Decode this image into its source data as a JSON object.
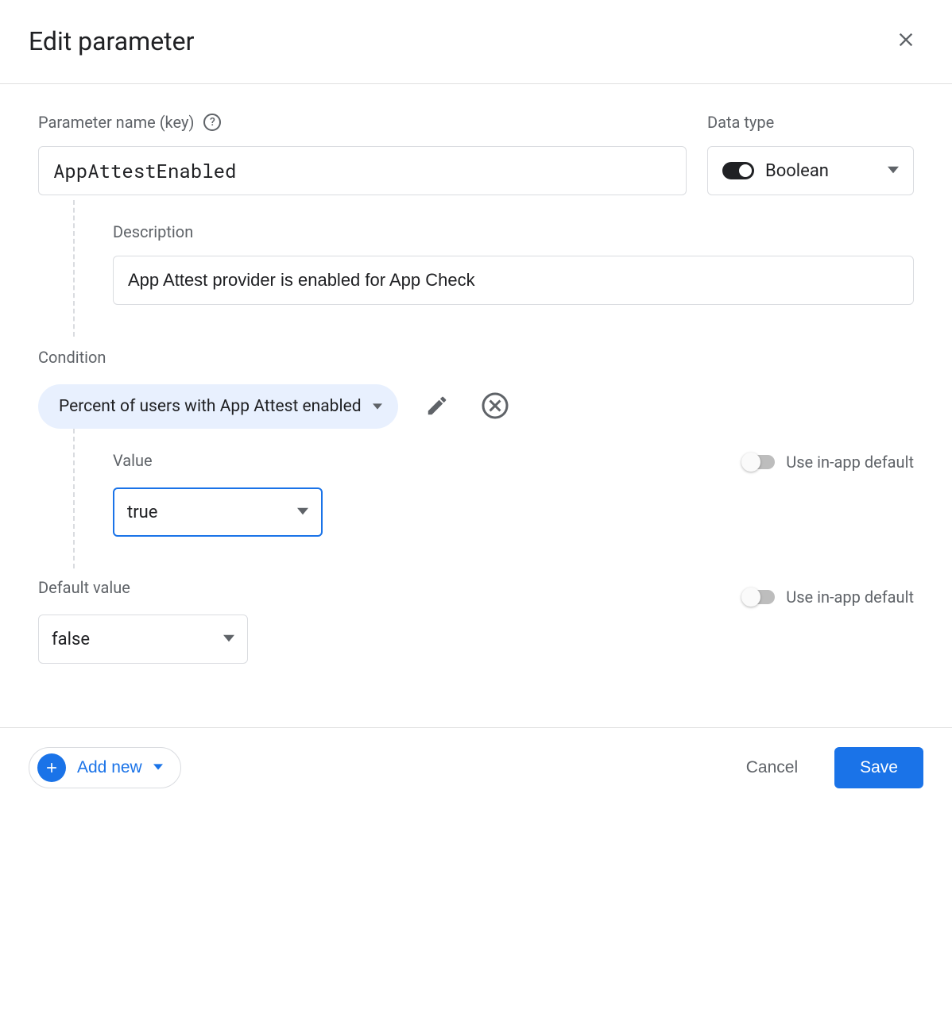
{
  "header": {
    "title": "Edit parameter"
  },
  "param": {
    "name_label": "Parameter name (key)",
    "name_value": "AppAttestEnabled",
    "datatype_label": "Data type",
    "datatype_value": "Boolean"
  },
  "description": {
    "label": "Description",
    "value": "App Attest provider is enabled for App Check"
  },
  "condition": {
    "section_label": "Condition",
    "chip_text": "Percent of users with App Attest enabled",
    "value_label": "Value",
    "value_selected": "true",
    "inapp_label": "Use in-app default"
  },
  "default": {
    "label": "Default value",
    "value_selected": "false",
    "inapp_label": "Use in-app default"
  },
  "footer": {
    "add_new": "Add new",
    "cancel": "Cancel",
    "save": "Save"
  }
}
